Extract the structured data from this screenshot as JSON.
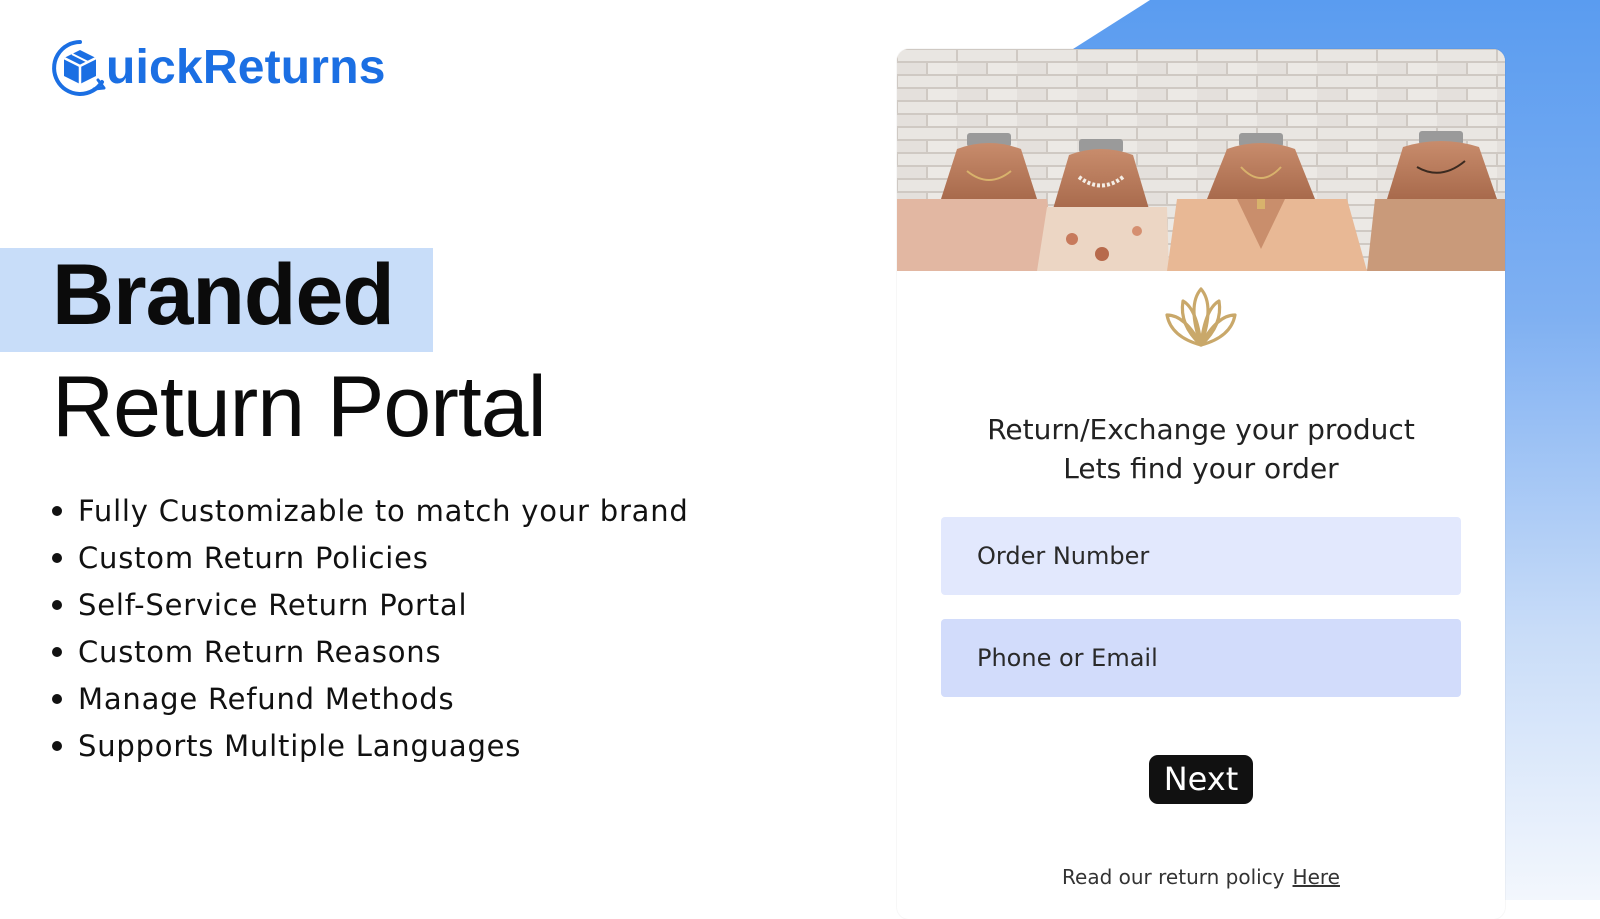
{
  "brand": {
    "logo_text": "uickReturns",
    "logo_icon": "box-return-icon",
    "brand_color": "#1b6fe3"
  },
  "hero_text": {
    "line1": "Branded",
    "line2": "Return Portal",
    "highlight_color": "#c8ddf9"
  },
  "features": [
    "Fully Customizable to match your brand",
    "Custom Return Policies",
    "Self-Service Return Portal",
    "Custom Return Reasons",
    "Manage Refund Methods",
    "Supports Multiple Languages"
  ],
  "portal": {
    "store_icon": "lotus-icon",
    "title_line1": "Return/Exchange your product",
    "title_line2": "Lets find your order",
    "order_field": {
      "placeholder": "Order Number",
      "value": ""
    },
    "contact_field": {
      "placeholder": "Phone or Email",
      "value": ""
    },
    "next_label": "Next",
    "policy_text": "Read our return policy",
    "policy_link": "Here"
  },
  "colors": {
    "accent_blue": "#5a9cf0",
    "order_field_bg": "#e2e8fd",
    "contact_field_bg": "#d2dcfb",
    "button_bg": "#111111",
    "lotus_gold": "#c9a86a"
  }
}
